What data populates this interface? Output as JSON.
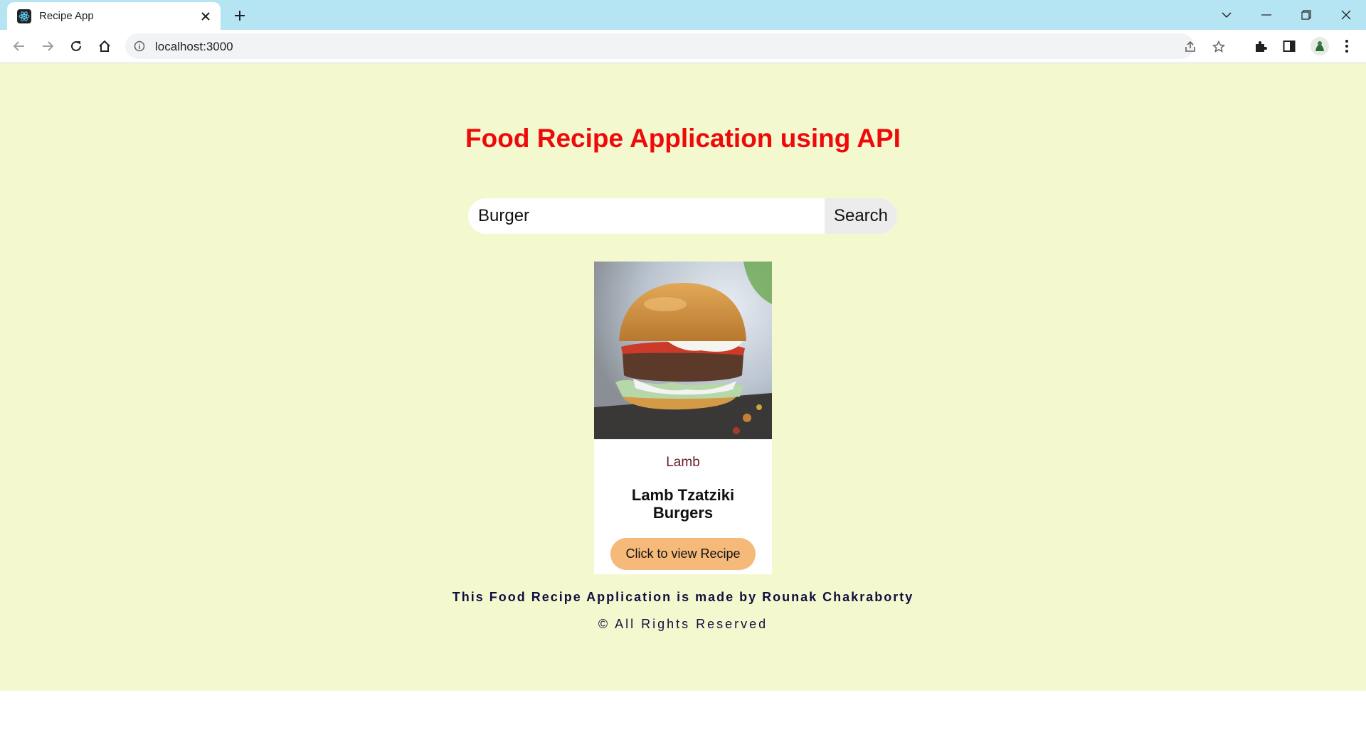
{
  "browser": {
    "tab_title": "Recipe App",
    "url": "localhost:3000"
  },
  "page": {
    "heading": "Food Recipe Application using API",
    "search": {
      "value": "Burger",
      "button_label": "Search"
    },
    "cards": [
      {
        "category": "Lamb",
        "title": "Lamb Tzatziki Burgers",
        "button_label": "Click to view Recipe"
      }
    ],
    "footer": {
      "line1": "This Food Recipe Application is made by Rounak Chakraborty",
      "line2": "© All Rights Reserved"
    }
  },
  "colors": {
    "page_background": "#f4f8cf",
    "heading": "#ee0a0a",
    "recipe_button": "#f5b97a",
    "tabstrip": "#b5e5f2"
  }
}
